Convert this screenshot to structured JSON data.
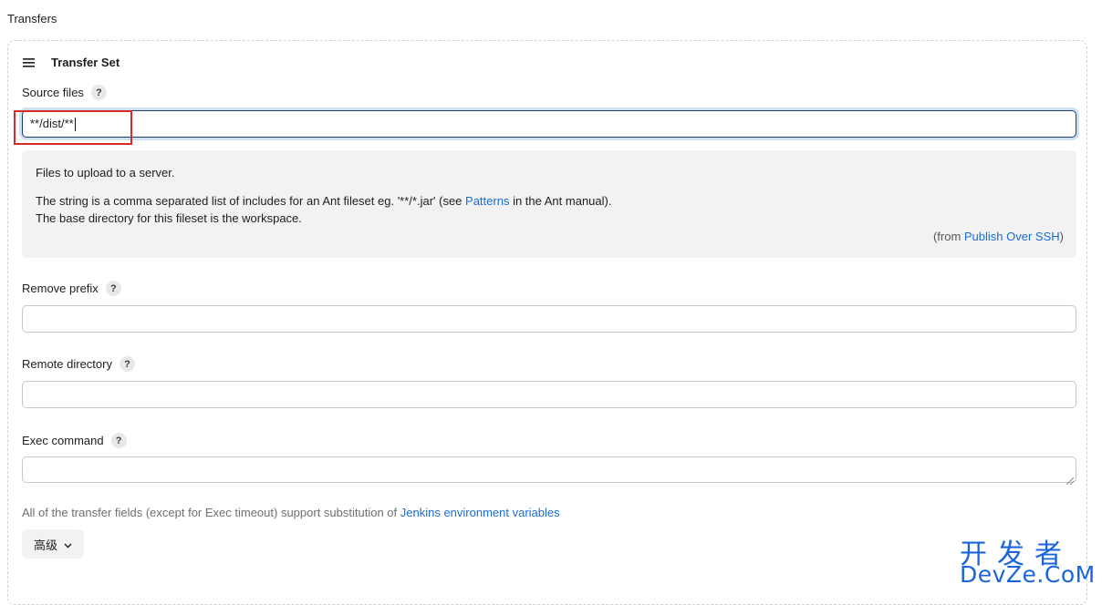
{
  "section": {
    "title": "Transfers"
  },
  "transfer_set": {
    "title": "Transfer Set",
    "source_files": {
      "label": "Source files",
      "help": "?",
      "value": "**/dist/**"
    },
    "help_panel": {
      "line1": "Files to upload to a server.",
      "line2_pre": "The string is a comma separated list of includes for an Ant fileset eg. '**/*.jar' (see ",
      "line2_link": "Patterns",
      "line2_post": " in the Ant manual).",
      "line3": "The base directory for this fileset is the workspace.",
      "from_pre": "(from ",
      "from_link": "Publish Over SSH",
      "from_post": ")"
    },
    "remove_prefix": {
      "label": "Remove prefix",
      "help": "?",
      "value": ""
    },
    "remote_directory": {
      "label": "Remote directory",
      "help": "?",
      "value": ""
    },
    "exec_command": {
      "label": "Exec command",
      "help": "?",
      "value": ""
    },
    "footer_pre": "All of the transfer fields (except for Exec timeout) support substitution of ",
    "footer_link": "Jenkins environment variables",
    "advanced_label": "高级"
  },
  "watermark": {
    "line1": "开发者",
    "line2": "DevZe.CoM"
  },
  "colors": {
    "link": "#1a6cd3",
    "annotation": "#d42b2b",
    "focus": "#1c3f6e"
  },
  "icons": [
    "drag-handle-icon",
    "help-icon",
    "chevron-down-icon",
    "resize-grip-icon"
  ]
}
